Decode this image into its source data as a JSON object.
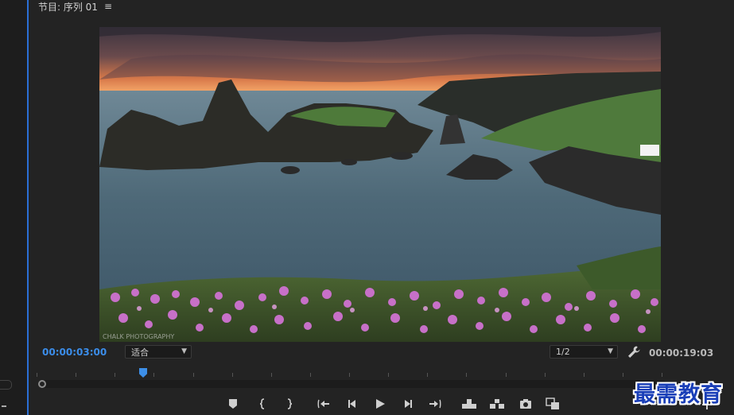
{
  "panel": {
    "title": "节目: 序列 01",
    "menu_icon": "hamburger-menu-icon"
  },
  "viewer": {
    "image": "coastal-sunset-landscape",
    "watermark_text": "CHALK PHOTOGRAPHY"
  },
  "controls": {
    "current_timecode": "00:00:03:00",
    "zoom_select": "适合",
    "resolution_select": "1/2",
    "duration_timecode": "00:00:19:03",
    "settings_icon": "wrench-icon",
    "accent": "#3b8dea"
  },
  "playhead": {
    "position_fraction": 0.17
  },
  "transport": {
    "buttons": [
      "add-marker-icon",
      "mark-in-icon",
      "mark-out-icon",
      "go-to-in-icon",
      "step-back-icon",
      "play-icon",
      "step-forward-icon",
      "go-to-out-icon",
      "lift-icon",
      "extract-icon",
      "export-frame-icon",
      "compare-view-icon"
    ]
  },
  "watermark": {
    "text": "最需教育",
    "color": "#1a3fb8"
  }
}
